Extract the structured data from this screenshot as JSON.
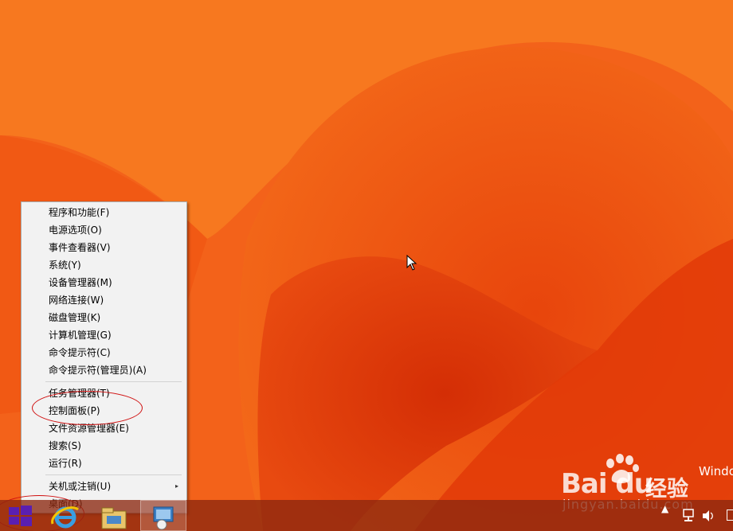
{
  "menu": {
    "items": [
      {
        "label": "程序和功能(F)"
      },
      {
        "label": "电源选项(O)"
      },
      {
        "label": "事件查看器(V)"
      },
      {
        "label": "系统(Y)"
      },
      {
        "label": "设备管理器(M)"
      },
      {
        "label": "网络连接(W)"
      },
      {
        "label": "磁盘管理(K)"
      },
      {
        "label": "计算机管理(G)"
      },
      {
        "label": "命令提示符(C)"
      },
      {
        "label": "命令提示符(管理员)(A)"
      },
      {
        "label": "任务管理器(T)"
      },
      {
        "label": "控制面板(P)"
      },
      {
        "label": "文件资源管理器(E)"
      },
      {
        "label": "搜索(S)"
      },
      {
        "label": "运行(R)"
      },
      {
        "label": "关机或注销(U)",
        "has_submenu": true
      },
      {
        "label": "桌面(D)"
      }
    ],
    "submenu_arrow": "▸"
  },
  "desktop": {
    "windows_text": "Windo"
  },
  "watermark": {
    "logo": "Bai du",
    "jingyan": "经验",
    "url": "jingyan.baidu.com"
  },
  "taskbar": {
    "buttons": [
      {
        "icon": "start-logo-icon"
      },
      {
        "icon": "ie-icon"
      },
      {
        "icon": "file-explorer-icon"
      },
      {
        "icon": "server-manager-icon"
      }
    ]
  },
  "tray": {
    "icons": [
      "chevron-up-icon",
      "network-icon",
      "volume-icon"
    ]
  },
  "colors": {
    "wallpaper": "#f25a10",
    "menu_bg": "#f2f2f2",
    "annotation": "#d01010"
  }
}
